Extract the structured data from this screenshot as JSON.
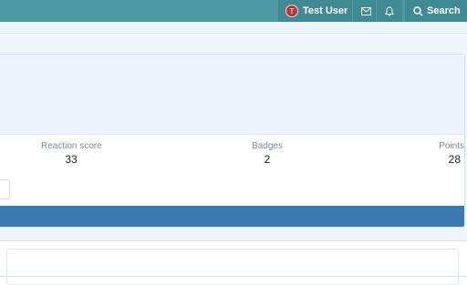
{
  "nav": {
    "user": {
      "avatar_letter": "T",
      "name": "Test User"
    },
    "icons": {
      "inbox": "envelope-icon",
      "alerts": "bell-icon",
      "search": "magnifier-icon"
    },
    "search_label": "Search"
  },
  "profile": {
    "stats": [
      {
        "label": "Reaction score",
        "value": "33"
      },
      {
        "label": "Badges",
        "value": "2"
      },
      {
        "label": "Points",
        "value": "28"
      }
    ]
  },
  "colors": {
    "nav_bar": "#4a9ba4",
    "nav_button": "#3f8a93",
    "avatar": "#b8363d",
    "tab_bar": "#3b79b2",
    "page_background": "#eef6f9",
    "banner": "#edf3fa"
  }
}
